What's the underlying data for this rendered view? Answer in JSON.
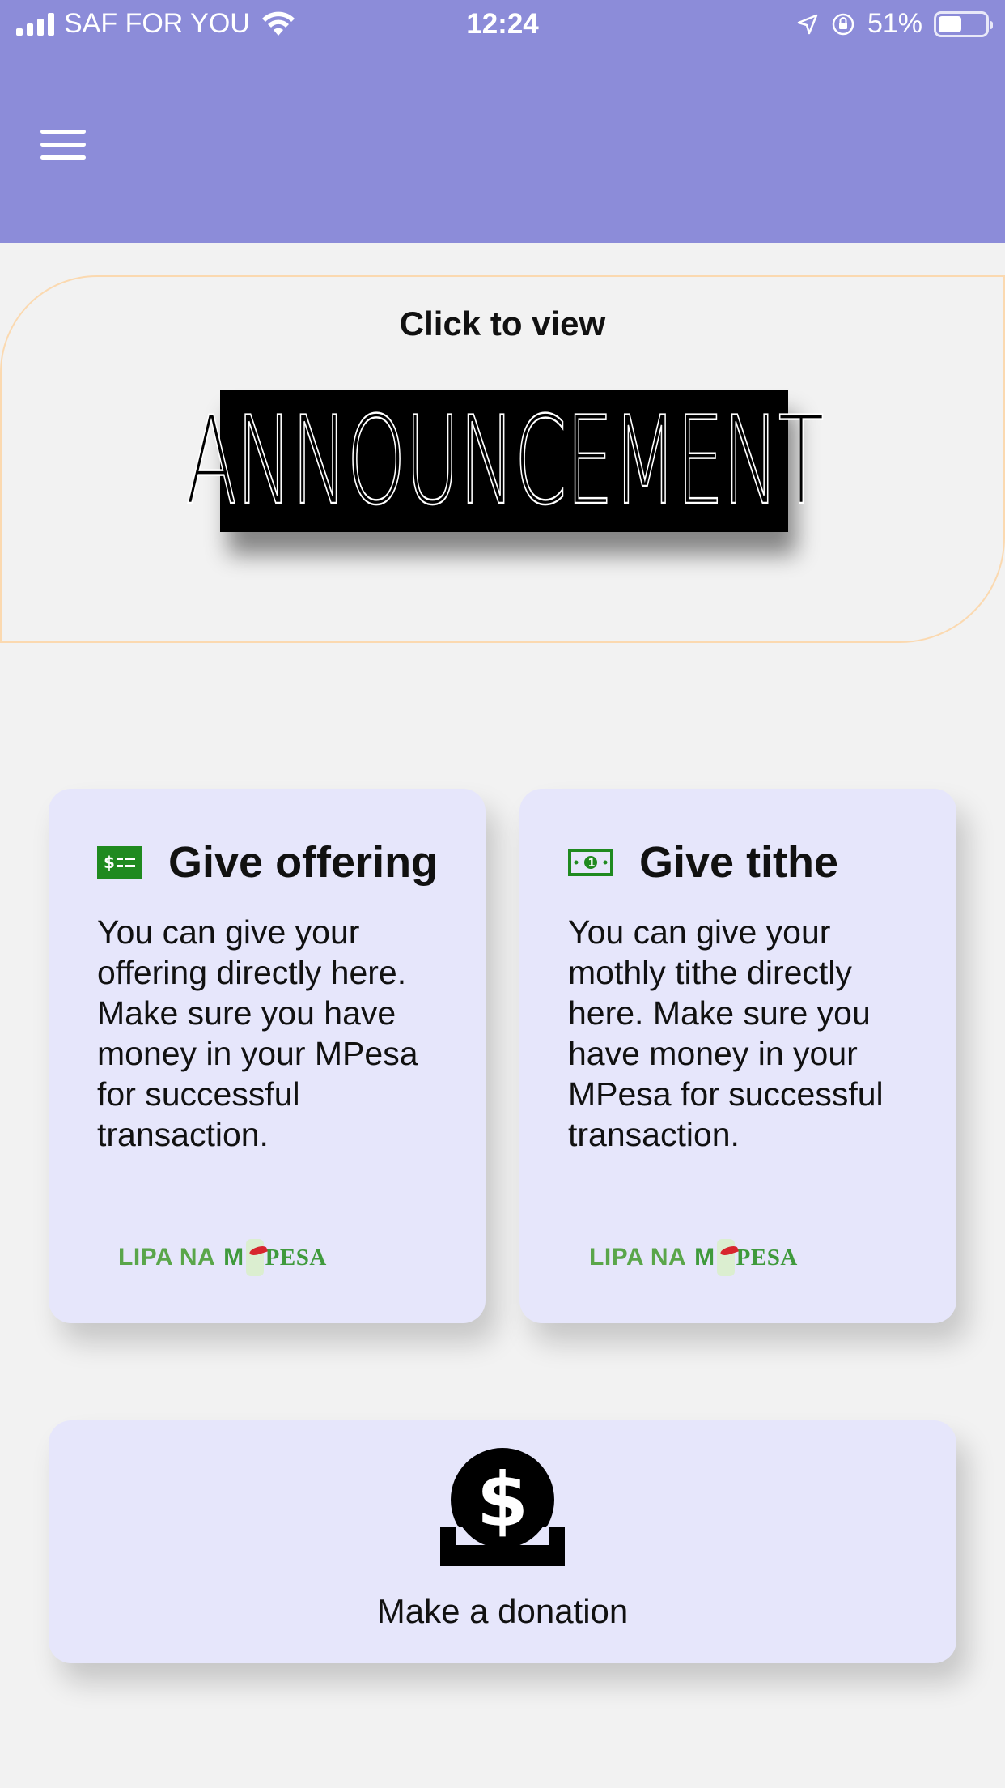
{
  "status_bar": {
    "carrier": "SAF FOR YOU",
    "time": "12:24",
    "battery": "51%",
    "battery_level": 0.51
  },
  "header": {
    "menu_icon": "hamburger-menu-icon",
    "background_color": "#8c8cd9"
  },
  "announcement": {
    "cta": "Click to view",
    "banner_text": "ANNOUNCEMENT"
  },
  "cards": {
    "offering": {
      "icon": "bill-icon",
      "title": "Give offering",
      "body": "You can give your offering directly here. Make sure you have money in your MPesa for successful transaction.",
      "payment": {
        "lipa": "LIPA NA",
        "m": "M",
        "pesa": "PESA"
      }
    },
    "tithe": {
      "icon": "money-icon",
      "title": "Give tithe",
      "body": "You can give your mothly tithe directly here. Make sure you have money in your MPesa for successful transaction.",
      "payment": {
        "lipa": "LIPA NA",
        "m": "M",
        "pesa": "PESA"
      }
    },
    "donation": {
      "icon": "donate-coin-icon",
      "label": "Make a donation"
    }
  },
  "colors": {
    "card_background": "#e6e6fb",
    "page_background": "#f2f2f2",
    "mpesa_green": "#5aa64a",
    "icon_green": "#1f8a1f"
  }
}
